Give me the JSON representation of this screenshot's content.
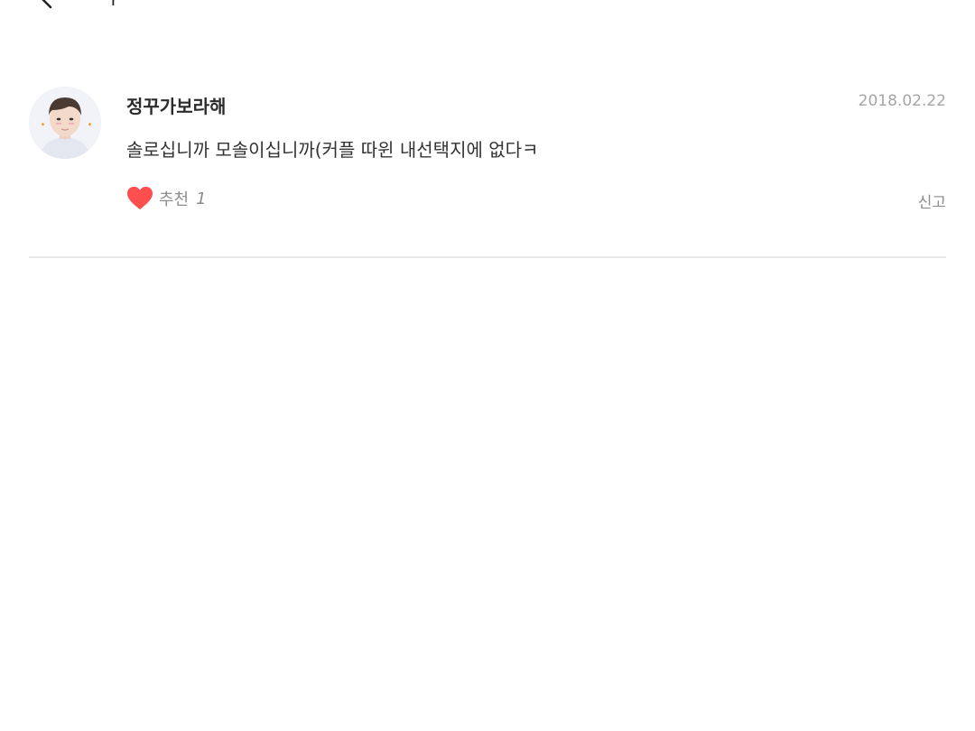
{
  "header": {
    "title": "ㄱ"
  },
  "comment": {
    "author": "정꾸가보라해",
    "date": "2018.02.22",
    "body": "솔로십니까 모솔이십니까(커플 따윈 내선택지에 없다ㅋ",
    "recommend_label": "추천",
    "recommend_count": "1",
    "report_label": "신고",
    "like_color": "#ff4e4e"
  },
  "colors": {
    "divider": "#e9e9e9",
    "date": "#a5a5a5",
    "meta": "#8d8d8d"
  }
}
